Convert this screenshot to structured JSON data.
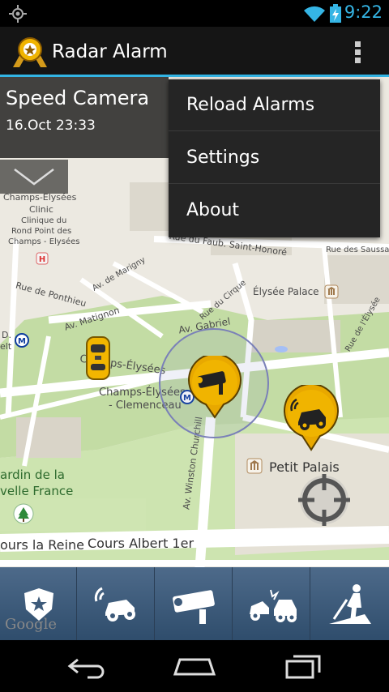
{
  "status_bar": {
    "time": "9:22"
  },
  "app": {
    "title": "Radar Alarm"
  },
  "alert": {
    "type": "Speed Camera",
    "datetime": "16.Oct 23:33"
  },
  "menu": {
    "items": [
      "Reload Alarms",
      "Settings",
      "About"
    ]
  },
  "map": {
    "labels": {
      "clinic1": "Champs-Elysées",
      "clinic2": "Clinic",
      "clinic3": "Clinique du",
      "clinic4": "Rond Point des",
      "clinic5": "Champs - Elysées",
      "faub": "Rue du Faub. Saint-Honoré",
      "elysee": "Élysée Palace",
      "ponthieu": "Rue de Ponthieu",
      "matignon": "Av. Matignon",
      "gabriel": "Av. Gabriel",
      "cirque": "Rue du Cirque",
      "marigny": "Av. de Marigny",
      "saussaies": "Rue des Saussaies",
      "elysee_av": "Rue de l'Élysée",
      "d": "D.",
      "elt": "elt",
      "champs": "Champs-Élysées",
      "metro": "Champs-Élysées",
      "metro2": "- Clemenceau",
      "churchill": "Av. Winston Churchill",
      "petit": "Petit Palais",
      "jardin1": "ardin de la",
      "jardin2": "velle France",
      "reine": "ours la Reine",
      "albert": "Cours Albert 1er",
      "google": "Google"
    }
  },
  "toolbar": {
    "buttons": [
      "police-alarm",
      "car-crash-alarm",
      "speed-camera-alarm",
      "accident-alarm",
      "roadworks-alarm"
    ]
  },
  "colors": {
    "accent": "#33b5e5",
    "marker": "#f0b400",
    "toolbar": "#3d5a7a"
  }
}
